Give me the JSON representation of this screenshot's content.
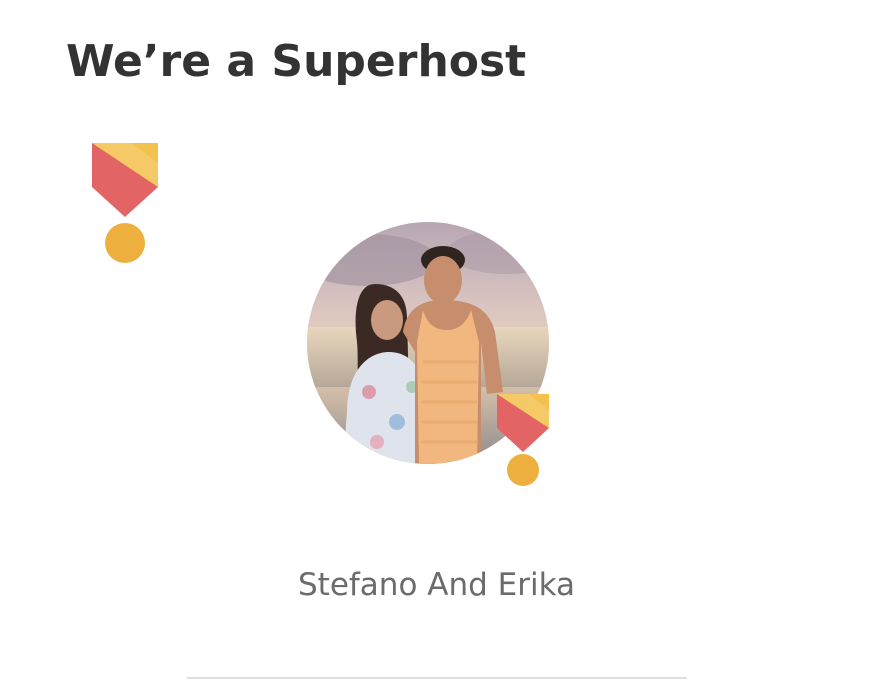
{
  "section": {
    "title": "We’re a Superhost"
  },
  "host": {
    "name": "Stefano And Erika"
  },
  "icons": {
    "section_badge": "superhost-medal-icon",
    "avatar_badge": "superhost-medal-icon"
  },
  "colors": {
    "title_text": "#333333",
    "name_text": "#6b6b6b",
    "medal_ribbon_red": "#e36464",
    "medal_ribbon_gold": "#f2c14e",
    "medal_coin": "#edb03f",
    "divider": "#dedede"
  }
}
